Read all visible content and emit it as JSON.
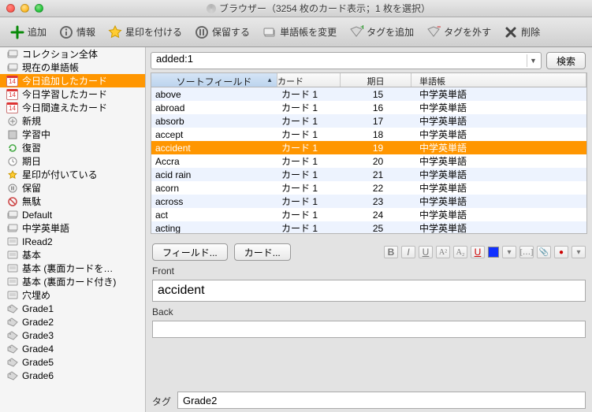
{
  "window": {
    "title": "ブラウザー（3254 枚のカード表示；1 枚を選択）"
  },
  "toolbar": {
    "add": "追加",
    "info": "情報",
    "star": "星印を付ける",
    "hold": "保留する",
    "changedeck": "単語帳を変更",
    "addtag": "タグを追加",
    "removetag": "タグを外す",
    "delete": "削除"
  },
  "sidebar": {
    "items": [
      {
        "icon": "deck",
        "label": "コレクション全体"
      },
      {
        "icon": "deck",
        "label": "現在の単語帳"
      },
      {
        "icon": "cal14",
        "label": "今日追加したカード",
        "selected": true
      },
      {
        "icon": "cal14",
        "label": "今日学習したカード"
      },
      {
        "icon": "cal14",
        "label": "今日間違えたカード"
      },
      {
        "icon": "plus",
        "label": "新規"
      },
      {
        "icon": "square",
        "label": "学習中"
      },
      {
        "icon": "refresh",
        "label": "復習"
      },
      {
        "icon": "clock",
        "label": "期日"
      },
      {
        "icon": "star",
        "label": "星印が付いている"
      },
      {
        "icon": "pause",
        "label": "保留"
      },
      {
        "icon": "ban",
        "label": "無駄"
      },
      {
        "icon": "deck",
        "label": "Default"
      },
      {
        "icon": "deck",
        "label": "中学英単語"
      },
      {
        "icon": "note",
        "label": "IRead2"
      },
      {
        "icon": "note",
        "label": "基本"
      },
      {
        "icon": "note",
        "label": "基本 (裏面カードを…"
      },
      {
        "icon": "note",
        "label": "基本 (裏面カード付き)"
      },
      {
        "icon": "note",
        "label": "穴埋め"
      },
      {
        "icon": "tag",
        "label": "Grade1"
      },
      {
        "icon": "tag",
        "label": "Grade2"
      },
      {
        "icon": "tag",
        "label": "Grade3"
      },
      {
        "icon": "tag",
        "label": "Grade4"
      },
      {
        "icon": "tag",
        "label": "Grade5"
      },
      {
        "icon": "tag",
        "label": "Grade6"
      }
    ]
  },
  "search": {
    "query": "added:1",
    "button": "検索"
  },
  "table": {
    "columns": [
      "ソートフィールド",
      "カード",
      "期日",
      "単語帳"
    ],
    "sorted_col": 0,
    "rows": [
      {
        "f": "above",
        "c": "カード 1",
        "d": "15",
        "deck": "中学英単語"
      },
      {
        "f": "abroad",
        "c": "カード 1",
        "d": "16",
        "deck": "中学英単語"
      },
      {
        "f": "absorb",
        "c": "カード 1",
        "d": "17",
        "deck": "中学英単語"
      },
      {
        "f": "accept",
        "c": "カード 1",
        "d": "18",
        "deck": "中学英単語"
      },
      {
        "f": "accident",
        "c": "カード 1",
        "d": "19",
        "deck": "中学英単語",
        "selected": true
      },
      {
        "f": "Accra",
        "c": "カード 1",
        "d": "20",
        "deck": "中学英単語"
      },
      {
        "f": "acid rain",
        "c": "カード 1",
        "d": "21",
        "deck": "中学英単語"
      },
      {
        "f": "acorn",
        "c": "カード 1",
        "d": "22",
        "deck": "中学英単語"
      },
      {
        "f": "across",
        "c": "カード 1",
        "d": "23",
        "deck": "中学英単語"
      },
      {
        "f": "act",
        "c": "カード 1",
        "d": "24",
        "deck": "中学英単語"
      },
      {
        "f": "acting",
        "c": "カード 1",
        "d": "25",
        "deck": "中学英単語"
      }
    ]
  },
  "editor": {
    "fields_btn": "フィールド...",
    "cards_btn": "カード...",
    "front_label": "Front",
    "front_value": "accident",
    "back_label": "Back",
    "back_value": "",
    "tag_label": "タグ",
    "tag_value": "Grade2"
  }
}
